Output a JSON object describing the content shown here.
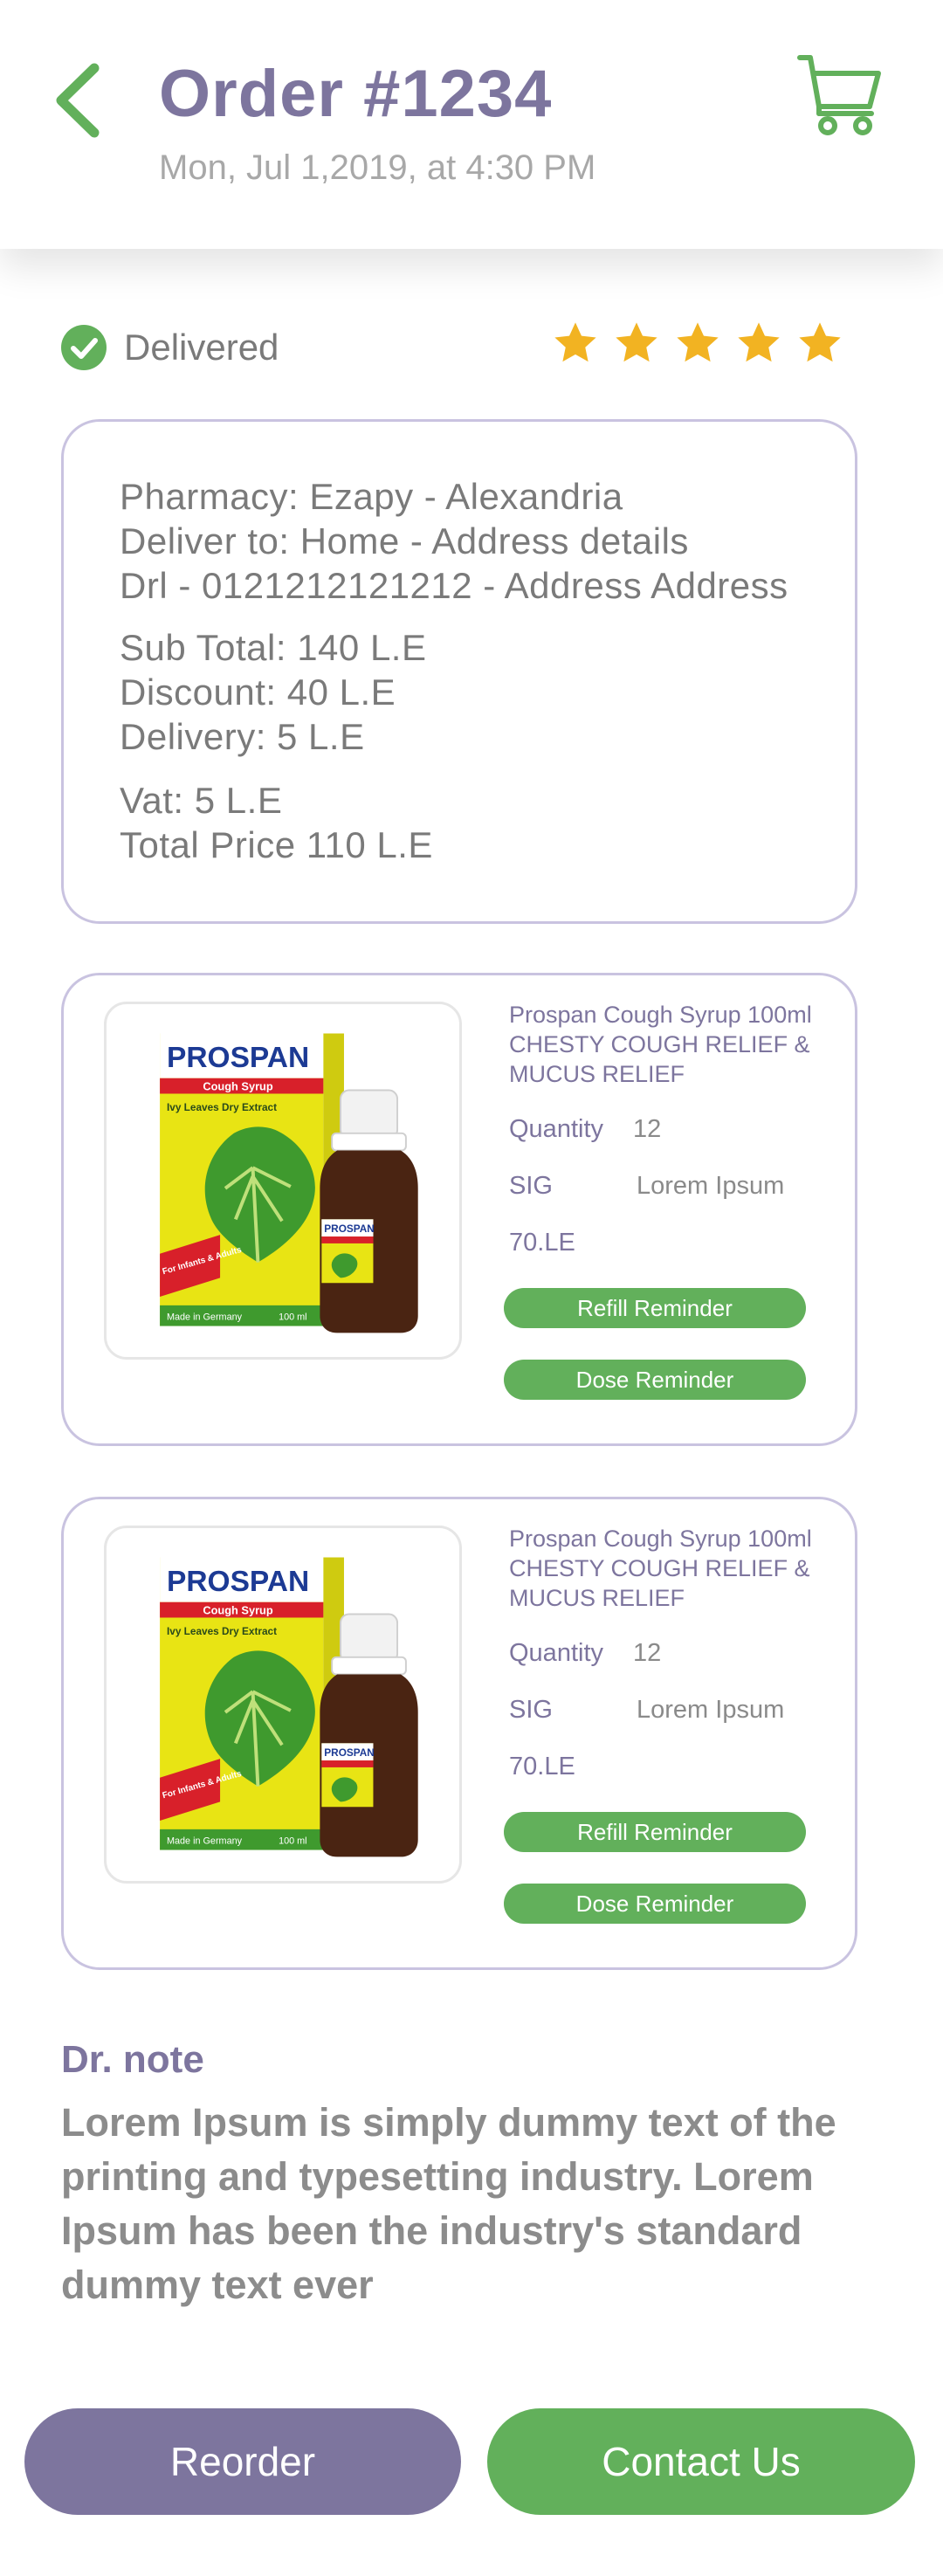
{
  "header": {
    "title": "Order #1234",
    "date": "Mon, Jul 1,2019, at 4:30 PM"
  },
  "status": {
    "label": "Delivered",
    "rating": 5,
    "max_rating": 5
  },
  "order_info": {
    "pharmacy": "Pharmacy: Ezapy - Alexandria",
    "deliver_to": "Deliver to: Home - Address details",
    "driver": "Drl - 0121212121212 - Address Address",
    "sub_total": "Sub Total: 140 L.E",
    "discount": "Discount: 40 L.E",
    "delivery": "Delivery: 5 L.E",
    "vat": "Vat: 5 L.E",
    "total": "Total Price 110 L.E"
  },
  "products": [
    {
      "name": "Prospan Cough Syrup 100ml CHESTY COUGH RELIEF & MUCUS RELIEF",
      "quantity_label": "Quantity",
      "quantity": "12",
      "sig_label": "SIG",
      "sig": "Lorem Ipsum",
      "price": "70.LE",
      "refill_label": "Refill Reminder",
      "dose_label": "Dose Reminder"
    },
    {
      "name": "Prospan Cough Syrup 100ml CHESTY COUGH RELIEF & MUCUS RELIEF",
      "quantity_label": "Quantity",
      "quantity": "12",
      "sig_label": "SIG",
      "sig": "Lorem Ipsum",
      "price": "70.LE",
      "refill_label": "Refill Reminder",
      "dose_label": "Dose Reminder"
    }
  ],
  "product_image": {
    "brand": "PROSPAN",
    "subtitle": "Cough Syrup",
    "ingredient": "Ivy Leaves Dry Extract",
    "badge": "For Infants & Adults",
    "made_in": "Made in Germany",
    "volume": "100 ml",
    "bottle_label": "PROSPAN"
  },
  "note": {
    "title": "Dr. note",
    "text": "Lorem Ipsum is simply dummy text of the printing and typesetting industry. Lorem Ipsum has been the industry's standard dummy text ever"
  },
  "actions": {
    "reorder": "Reorder",
    "contact": "Contact Us"
  },
  "colors": {
    "brand_purple": "#7d759e",
    "brand_green": "#62b05b",
    "star_gold": "#f2b322",
    "card_border": "#c9c3e0"
  }
}
